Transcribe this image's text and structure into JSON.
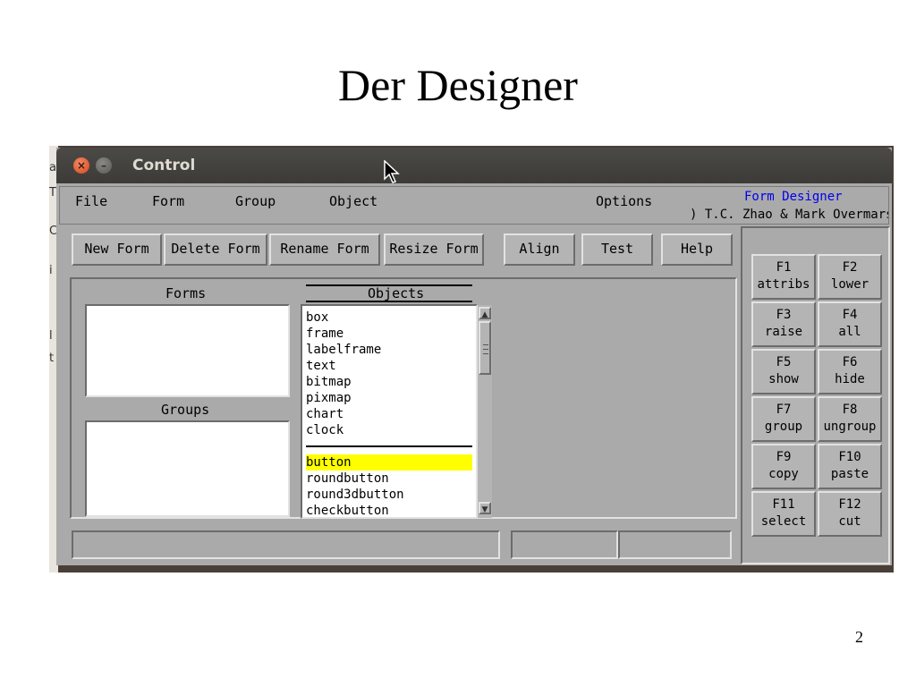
{
  "slide": {
    "title": "Der Designer",
    "number": "2"
  },
  "desktop": {
    "strip_glyphs": [
      "a",
      "T",
      "C",
      "i",
      "l",
      "t"
    ]
  },
  "window": {
    "title": "Control"
  },
  "menu": {
    "items": [
      "File",
      "Form",
      "Group",
      "Object",
      "Options"
    ],
    "app_title": "Form Designer",
    "authors": ") T.C. Zhao & Mark Overmars"
  },
  "toolbar": {
    "buttons": [
      "New Form",
      "Delete Form",
      "Rename Form",
      "Resize Form",
      "Align",
      "Test",
      "Help"
    ]
  },
  "panels": {
    "forms_label": "Forms",
    "groups_label": "Groups",
    "objects_label": "Objects"
  },
  "objects": {
    "items_top": [
      "box",
      "frame",
      "labelframe",
      "text",
      "bitmap",
      "pixmap",
      "chart",
      "clock"
    ],
    "items_bottom": [
      "button",
      "roundbutton",
      "round3dbutton",
      "checkbutton"
    ],
    "selected": "button",
    "selected_color": "#ffff00"
  },
  "fkeys": [
    {
      "key": "F1",
      "action": "attribs"
    },
    {
      "key": "F2",
      "action": "lower"
    },
    {
      "key": "F3",
      "action": "raise"
    },
    {
      "key": "F4",
      "action": "all"
    },
    {
      "key": "F5",
      "action": "show"
    },
    {
      "key": "F6",
      "action": "hide"
    },
    {
      "key": "F7",
      "action": "group"
    },
    {
      "key": "F8",
      "action": "ungroup"
    },
    {
      "key": "F9",
      "action": "copy"
    },
    {
      "key": "F10",
      "action": "paste"
    },
    {
      "key": "F11",
      "action": "select"
    },
    {
      "key": "F12",
      "action": "cut"
    }
  ],
  "colors": {
    "app_title": "#0000ee",
    "window_bg": "#aaaaaa",
    "titlebar": "#3c3b37"
  },
  "icons": {
    "close": "close-icon",
    "minimize": "minimize-icon",
    "cursor": "mouse-cursor-icon"
  }
}
